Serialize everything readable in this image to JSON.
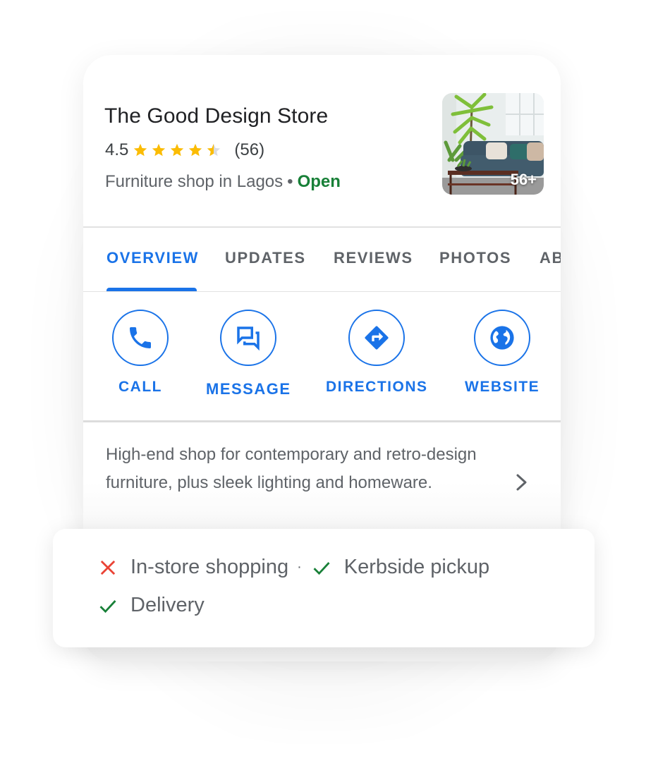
{
  "place": {
    "name": "The Good Design Store",
    "rating": "4.5",
    "rating_value": 4.5,
    "rating_max": 5,
    "review_count": "(56)",
    "category": "Furniture shop in Lagos",
    "separator": "•",
    "status": "Open",
    "photo_count": "56+"
  },
  "tabs": [
    {
      "label": "OVERVIEW",
      "active": true
    },
    {
      "label": "UPDATES",
      "active": false
    },
    {
      "label": "REVIEWS",
      "active": false
    },
    {
      "label": "PHOTOS",
      "active": false
    },
    {
      "label": "AB",
      "active": false
    }
  ],
  "actions": [
    {
      "label": "CALL",
      "icon": "phone-icon"
    },
    {
      "label": "MESSAGE",
      "icon": "message-icon"
    },
    {
      "label": "DIRECTIONS",
      "icon": "directions-icon"
    },
    {
      "label": "WEBSITE",
      "icon": "globe-icon"
    }
  ],
  "description": "High-end shop for contemporary and retro-design furniture, plus sleek lighting and homeware.",
  "features": [
    {
      "label": "In-store shopping",
      "available": false
    },
    {
      "label": "Kerbside pickup",
      "available": true
    },
    {
      "label": "Delivery",
      "available": true
    }
  ],
  "feature_separator": "·",
  "colors": {
    "accent": "#1a73e8",
    "open": "#188038",
    "star": "#fbbc04",
    "star_empty": "#dadce0",
    "unavailable": "#ea4335",
    "available": "#188038",
    "text_primary": "#202124",
    "text_secondary": "#5f6368"
  }
}
